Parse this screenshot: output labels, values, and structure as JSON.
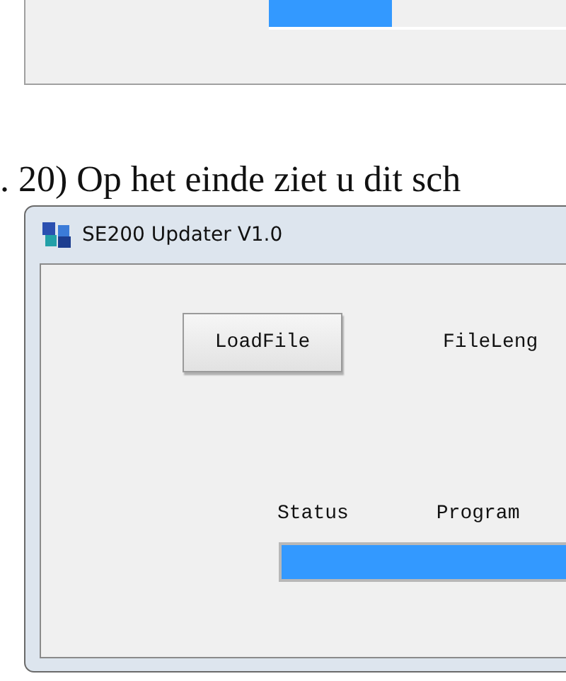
{
  "top_panel": {
    "progress": {
      "level": 0.41
    }
  },
  "caption": ". 20) Op het einde ziet u dit sch",
  "window": {
    "title": "SE200 Updater V1.0",
    "load_button": "LoadFile",
    "file_length_label": "FileLeng",
    "status_label": "Status",
    "program_label": "Program",
    "progress": {
      "level": 1
    }
  }
}
